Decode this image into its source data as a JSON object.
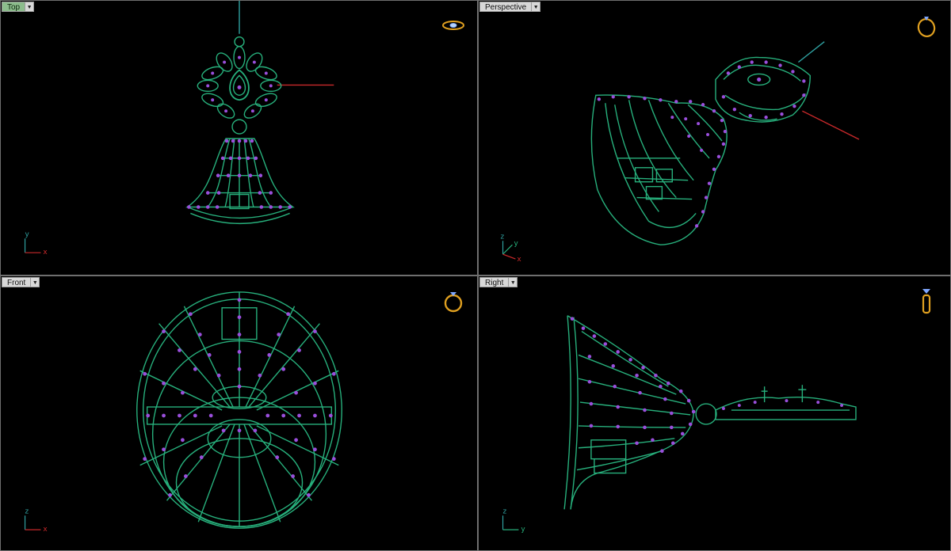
{
  "viewports": {
    "top": {
      "label": "Top",
      "axes": {
        "vertical": "y",
        "horizontal": "x"
      }
    },
    "perspective": {
      "label": "Perspective",
      "axes": {
        "vertical": "z",
        "horizontal": "y",
        "depth": "x"
      }
    },
    "front": {
      "label": "Front",
      "axes": {
        "vertical": "z",
        "horizontal": "x"
      }
    },
    "right": {
      "label": "Right",
      "axes": {
        "vertical": "z",
        "horizontal": "y"
      }
    }
  },
  "icons": {
    "view_menu": "dropdown-arrow-icon",
    "view_gizmo": "ring-gizmo-icon"
  },
  "colors": {
    "background": "#000000",
    "wire_green": "#27b07c",
    "gem_purple": "#9a4fdc",
    "axis_x": "#c8282a",
    "axis_y": "#2fa0a0",
    "active_tab": "#8dbd8d",
    "gizmo_gold": "#e0a020"
  }
}
